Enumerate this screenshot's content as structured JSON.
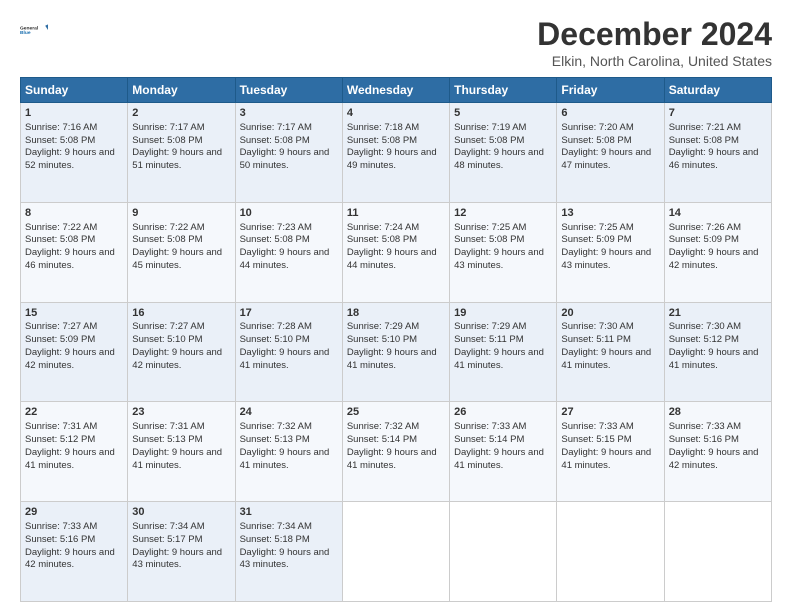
{
  "logo": {
    "line1": "General",
    "line2": "Blue"
  },
  "title": "December 2024",
  "location": "Elkin, North Carolina, United States",
  "days_header": [
    "Sunday",
    "Monday",
    "Tuesday",
    "Wednesday",
    "Thursday",
    "Friday",
    "Saturday"
  ],
  "weeks": [
    [
      {
        "day": "1",
        "rise": "7:16 AM",
        "set": "5:08 PM",
        "daylight": "9 hours and 52 minutes."
      },
      {
        "day": "2",
        "rise": "7:17 AM",
        "set": "5:08 PM",
        "daylight": "9 hours and 51 minutes."
      },
      {
        "day": "3",
        "rise": "7:17 AM",
        "set": "5:08 PM",
        "daylight": "9 hours and 50 minutes."
      },
      {
        "day": "4",
        "rise": "7:18 AM",
        "set": "5:08 PM",
        "daylight": "9 hours and 49 minutes."
      },
      {
        "day": "5",
        "rise": "7:19 AM",
        "set": "5:08 PM",
        "daylight": "9 hours and 48 minutes."
      },
      {
        "day": "6",
        "rise": "7:20 AM",
        "set": "5:08 PM",
        "daylight": "9 hours and 47 minutes."
      },
      {
        "day": "7",
        "rise": "7:21 AM",
        "set": "5:08 PM",
        "daylight": "9 hours and 46 minutes."
      }
    ],
    [
      {
        "day": "8",
        "rise": "7:22 AM",
        "set": "5:08 PM",
        "daylight": "9 hours and 46 minutes."
      },
      {
        "day": "9",
        "rise": "7:22 AM",
        "set": "5:08 PM",
        "daylight": "9 hours and 45 minutes."
      },
      {
        "day": "10",
        "rise": "7:23 AM",
        "set": "5:08 PM",
        "daylight": "9 hours and 44 minutes."
      },
      {
        "day": "11",
        "rise": "7:24 AM",
        "set": "5:08 PM",
        "daylight": "9 hours and 44 minutes."
      },
      {
        "day": "12",
        "rise": "7:25 AM",
        "set": "5:08 PM",
        "daylight": "9 hours and 43 minutes."
      },
      {
        "day": "13",
        "rise": "7:25 AM",
        "set": "5:09 PM",
        "daylight": "9 hours and 43 minutes."
      },
      {
        "day": "14",
        "rise": "7:26 AM",
        "set": "5:09 PM",
        "daylight": "9 hours and 42 minutes."
      }
    ],
    [
      {
        "day": "15",
        "rise": "7:27 AM",
        "set": "5:09 PM",
        "daylight": "9 hours and 42 minutes."
      },
      {
        "day": "16",
        "rise": "7:27 AM",
        "set": "5:10 PM",
        "daylight": "9 hours and 42 minutes."
      },
      {
        "day": "17",
        "rise": "7:28 AM",
        "set": "5:10 PM",
        "daylight": "9 hours and 41 minutes."
      },
      {
        "day": "18",
        "rise": "7:29 AM",
        "set": "5:10 PM",
        "daylight": "9 hours and 41 minutes."
      },
      {
        "day": "19",
        "rise": "7:29 AM",
        "set": "5:11 PM",
        "daylight": "9 hours and 41 minutes."
      },
      {
        "day": "20",
        "rise": "7:30 AM",
        "set": "5:11 PM",
        "daylight": "9 hours and 41 minutes."
      },
      {
        "day": "21",
        "rise": "7:30 AM",
        "set": "5:12 PM",
        "daylight": "9 hours and 41 minutes."
      }
    ],
    [
      {
        "day": "22",
        "rise": "7:31 AM",
        "set": "5:12 PM",
        "daylight": "9 hours and 41 minutes."
      },
      {
        "day": "23",
        "rise": "7:31 AM",
        "set": "5:13 PM",
        "daylight": "9 hours and 41 minutes."
      },
      {
        "day": "24",
        "rise": "7:32 AM",
        "set": "5:13 PM",
        "daylight": "9 hours and 41 minutes."
      },
      {
        "day": "25",
        "rise": "7:32 AM",
        "set": "5:14 PM",
        "daylight": "9 hours and 41 minutes."
      },
      {
        "day": "26",
        "rise": "7:33 AM",
        "set": "5:14 PM",
        "daylight": "9 hours and 41 minutes."
      },
      {
        "day": "27",
        "rise": "7:33 AM",
        "set": "5:15 PM",
        "daylight": "9 hours and 41 minutes."
      },
      {
        "day": "28",
        "rise": "7:33 AM",
        "set": "5:16 PM",
        "daylight": "9 hours and 42 minutes."
      }
    ],
    [
      {
        "day": "29",
        "rise": "7:33 AM",
        "set": "5:16 PM",
        "daylight": "9 hours and 42 minutes."
      },
      {
        "day": "30",
        "rise": "7:34 AM",
        "set": "5:17 PM",
        "daylight": "9 hours and 43 minutes."
      },
      {
        "day": "31",
        "rise": "7:34 AM",
        "set": "5:18 PM",
        "daylight": "9 hours and 43 minutes."
      },
      null,
      null,
      null,
      null
    ]
  ]
}
